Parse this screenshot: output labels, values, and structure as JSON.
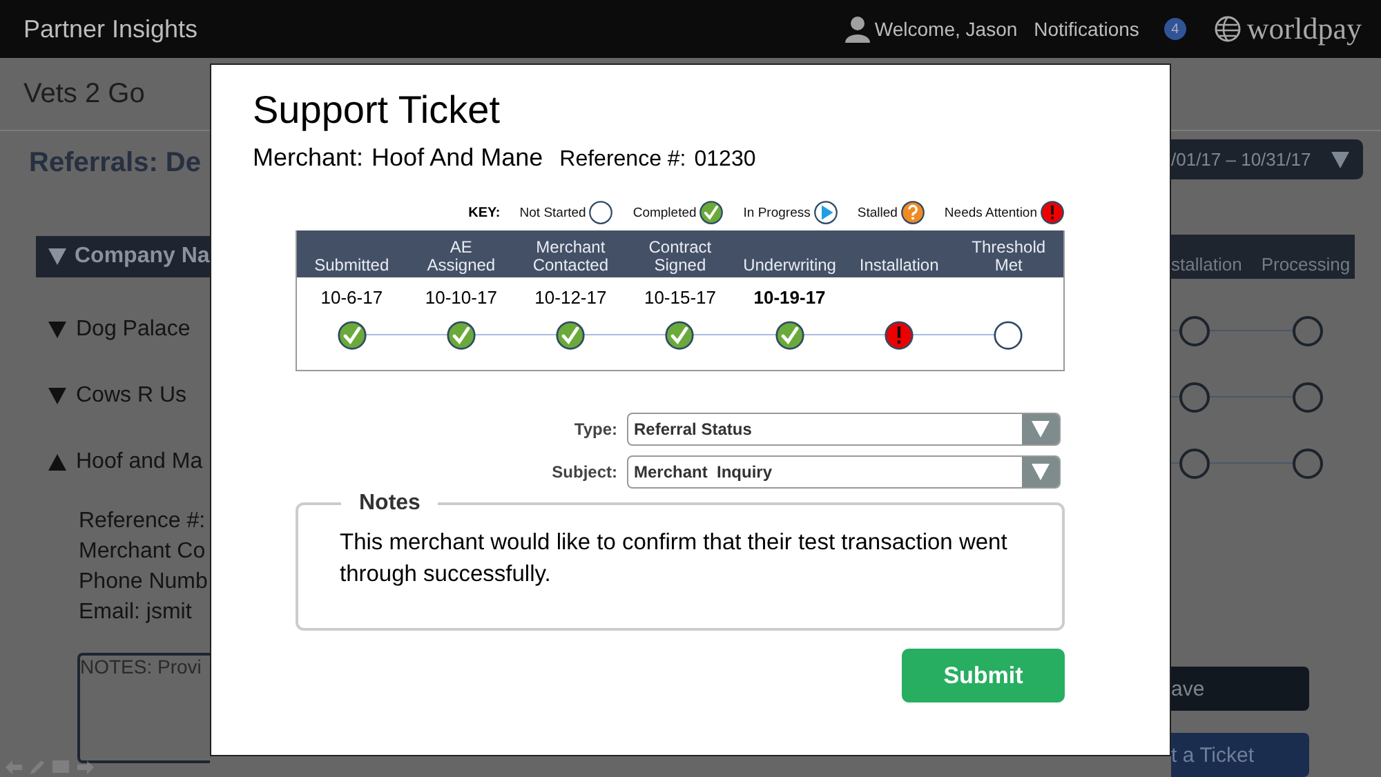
{
  "header": {
    "title": "Partner Insights",
    "welcome": "Welcome, Jason",
    "notifications": "Notifications",
    "notification_count": "4",
    "logo": "worldpay"
  },
  "background": {
    "merchant_name": "Vets 2 Go",
    "section_title": "Referrals: De",
    "date_range": "/01/17 – 10/31/17",
    "company_column": "Company Na",
    "stage_columns": [
      "stallation",
      "Processing"
    ],
    "companies": [
      {
        "name": "Dog Palace",
        "expanded": false,
        "stages": [
          {
            "kind": "not_started"
          },
          {
            "kind": "not_started"
          }
        ]
      },
      {
        "name": "Cows R Us",
        "expanded": false,
        "stages": [
          {
            "kind": "not_started"
          },
          {
            "kind": "not_started"
          }
        ]
      },
      {
        "name": "Hoof and Ma",
        "expanded": true,
        "stages": [
          {
            "kind": "not_started"
          },
          {
            "kind": "not_started"
          }
        ],
        "details": [
          "Reference #:",
          "Merchant Co",
          "Phone Numb",
          "Email:  jsmit"
        ],
        "notes": "NOTES:  Provi"
      }
    ],
    "buttons": [
      {
        "label": "ave",
        "kind": "dark"
      },
      {
        "label": "t a Ticket",
        "kind": "primary"
      }
    ]
  },
  "modal": {
    "title": "Support Ticket",
    "merchant_label": "Merchant:",
    "merchant": "Hoof And Mane",
    "reference_label": "Reference #:",
    "reference": "01230",
    "key": {
      "label": "KEY:",
      "items": [
        {
          "label": "Not Started",
          "kind": "not_started"
        },
        {
          "label": "Completed",
          "kind": "completed"
        },
        {
          "label": "In Progress",
          "kind": "in_progress"
        },
        {
          "label": "Stalled",
          "kind": "stalled"
        },
        {
          "label": "Needs Attention",
          "kind": "needs_attention"
        }
      ]
    },
    "steps": [
      {
        "label": "Submitted",
        "date": "10-6-17",
        "bold": false,
        "kind": "completed"
      },
      {
        "label": "AE Assigned",
        "date": "10-10-17",
        "bold": false,
        "kind": "completed"
      },
      {
        "label": "Merchant Contacted",
        "date": "10-12-17",
        "bold": false,
        "kind": "completed"
      },
      {
        "label": "Contract Signed",
        "date": "10-15-17",
        "bold": false,
        "kind": "completed"
      },
      {
        "label": "Underwriting",
        "date": "10-19-17",
        "bold": true,
        "kind": "completed"
      },
      {
        "label": "Installation",
        "kind": "needs_attention"
      },
      {
        "label": "Threshold Met",
        "kind": "not_started"
      }
    ],
    "fields": [
      {
        "label": "Type:",
        "value": "Referral Status"
      },
      {
        "label": "Subject:",
        "value": "Merchant  Inquiry"
      }
    ],
    "notes": {
      "legend": "Notes",
      "text": "This merchant would like to confirm that their test transaction went through successfully."
    },
    "submit": "Submit"
  }
}
